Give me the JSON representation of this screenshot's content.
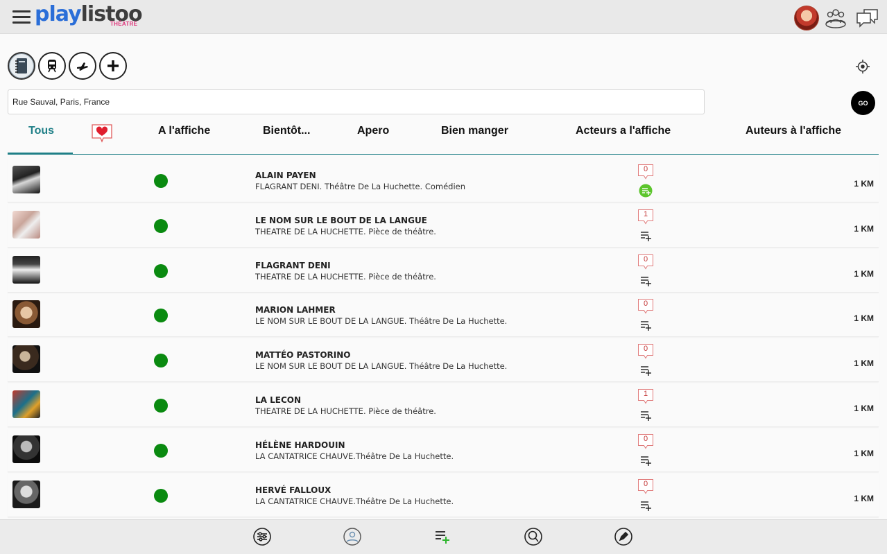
{
  "header": {
    "logo_main_a": "play",
    "logo_main_b": "listoo",
    "logo_sub": "THÉATRE"
  },
  "search": {
    "value": "Rue Sauval, Paris, France",
    "go_label": "GO"
  },
  "tabs": [
    {
      "label": "Tous"
    },
    {
      "label": "A l'affiche"
    },
    {
      "label": "Bientôt..."
    },
    {
      "label": "Apero"
    },
    {
      "label": "Bien manger"
    },
    {
      "label": "Acteurs a l'affiche"
    },
    {
      "label": "Auteurs à l'affiche"
    }
  ],
  "colors": {
    "accent": "#1f7f87",
    "brand_blue": "#2a6ed8",
    "status_green": "#0a8a10",
    "badge_red": "#c43a3a"
  },
  "rows": [
    {
      "title": "ALAIN PAYEN",
      "subtitle": "FLAGRANT DENI. Théâtre De La Huchette. Comédien",
      "count": "0",
      "distance": "1 KM"
    },
    {
      "title": "LE NOM SUR LE BOUT DE LA LANGUE",
      "subtitle": "THEATRE DE LA HUCHETTE. Pièce de théâtre.",
      "count": "1",
      "distance": "1 KM"
    },
    {
      "title": "FLAGRANT DENI",
      "subtitle": "THEATRE DE LA HUCHETTE. Pièce de théâtre.",
      "count": "0",
      "distance": "1 KM"
    },
    {
      "title": "MARION LAHMER",
      "subtitle": "LE NOM SUR LE BOUT DE LA LANGUE. Théâtre De La Huchette.",
      "count": "0",
      "distance": "1 KM"
    },
    {
      "title": "MATTÉO PASTORINO",
      "subtitle": "LE NOM SUR LE BOUT DE LA LANGUE. Théâtre De La Huchette.",
      "count": "0",
      "distance": "1 KM"
    },
    {
      "title": "LA LECON",
      "subtitle": "THEATRE DE LA HUCHETTE. Pièce de théâtre.",
      "count": "1",
      "distance": "1 KM"
    },
    {
      "title": "HÉLÈNE HARDOUIN",
      "subtitle": "LA CANTATRICE CHAUVE.Théâtre De La Huchette.",
      "count": "0",
      "distance": "1 KM"
    },
    {
      "title": "HERVÉ FALLOUX",
      "subtitle": "LA CANTATRICE CHAUVE.Théâtre De La Huchette.",
      "count": "0",
      "distance": "1 KM"
    }
  ]
}
